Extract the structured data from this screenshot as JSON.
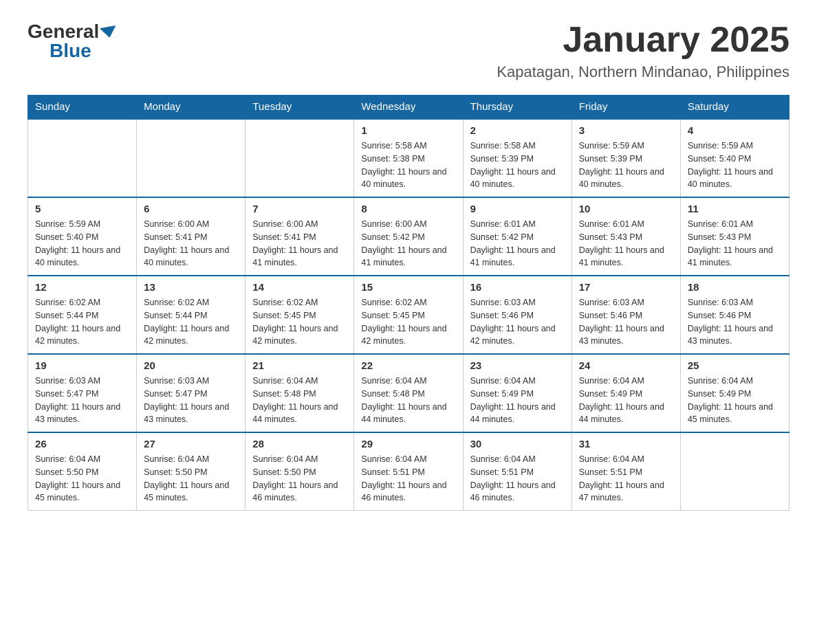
{
  "logo": {
    "general": "General",
    "blue": "Blue"
  },
  "title": "January 2025",
  "location": "Kapatagan, Northern Mindanao, Philippines",
  "weekdays": [
    "Sunday",
    "Monday",
    "Tuesday",
    "Wednesday",
    "Thursday",
    "Friday",
    "Saturday"
  ],
  "weeks": [
    [
      {
        "day": "",
        "info": ""
      },
      {
        "day": "",
        "info": ""
      },
      {
        "day": "",
        "info": ""
      },
      {
        "day": "1",
        "info": "Sunrise: 5:58 AM\nSunset: 5:38 PM\nDaylight: 11 hours and 40 minutes."
      },
      {
        "day": "2",
        "info": "Sunrise: 5:58 AM\nSunset: 5:39 PM\nDaylight: 11 hours and 40 minutes."
      },
      {
        "day": "3",
        "info": "Sunrise: 5:59 AM\nSunset: 5:39 PM\nDaylight: 11 hours and 40 minutes."
      },
      {
        "day": "4",
        "info": "Sunrise: 5:59 AM\nSunset: 5:40 PM\nDaylight: 11 hours and 40 minutes."
      }
    ],
    [
      {
        "day": "5",
        "info": "Sunrise: 5:59 AM\nSunset: 5:40 PM\nDaylight: 11 hours and 40 minutes."
      },
      {
        "day": "6",
        "info": "Sunrise: 6:00 AM\nSunset: 5:41 PM\nDaylight: 11 hours and 40 minutes."
      },
      {
        "day": "7",
        "info": "Sunrise: 6:00 AM\nSunset: 5:41 PM\nDaylight: 11 hours and 41 minutes."
      },
      {
        "day": "8",
        "info": "Sunrise: 6:00 AM\nSunset: 5:42 PM\nDaylight: 11 hours and 41 minutes."
      },
      {
        "day": "9",
        "info": "Sunrise: 6:01 AM\nSunset: 5:42 PM\nDaylight: 11 hours and 41 minutes."
      },
      {
        "day": "10",
        "info": "Sunrise: 6:01 AM\nSunset: 5:43 PM\nDaylight: 11 hours and 41 minutes."
      },
      {
        "day": "11",
        "info": "Sunrise: 6:01 AM\nSunset: 5:43 PM\nDaylight: 11 hours and 41 minutes."
      }
    ],
    [
      {
        "day": "12",
        "info": "Sunrise: 6:02 AM\nSunset: 5:44 PM\nDaylight: 11 hours and 42 minutes."
      },
      {
        "day": "13",
        "info": "Sunrise: 6:02 AM\nSunset: 5:44 PM\nDaylight: 11 hours and 42 minutes."
      },
      {
        "day": "14",
        "info": "Sunrise: 6:02 AM\nSunset: 5:45 PM\nDaylight: 11 hours and 42 minutes."
      },
      {
        "day": "15",
        "info": "Sunrise: 6:02 AM\nSunset: 5:45 PM\nDaylight: 11 hours and 42 minutes."
      },
      {
        "day": "16",
        "info": "Sunrise: 6:03 AM\nSunset: 5:46 PM\nDaylight: 11 hours and 42 minutes."
      },
      {
        "day": "17",
        "info": "Sunrise: 6:03 AM\nSunset: 5:46 PM\nDaylight: 11 hours and 43 minutes."
      },
      {
        "day": "18",
        "info": "Sunrise: 6:03 AM\nSunset: 5:46 PM\nDaylight: 11 hours and 43 minutes."
      }
    ],
    [
      {
        "day": "19",
        "info": "Sunrise: 6:03 AM\nSunset: 5:47 PM\nDaylight: 11 hours and 43 minutes."
      },
      {
        "day": "20",
        "info": "Sunrise: 6:03 AM\nSunset: 5:47 PM\nDaylight: 11 hours and 43 minutes."
      },
      {
        "day": "21",
        "info": "Sunrise: 6:04 AM\nSunset: 5:48 PM\nDaylight: 11 hours and 44 minutes."
      },
      {
        "day": "22",
        "info": "Sunrise: 6:04 AM\nSunset: 5:48 PM\nDaylight: 11 hours and 44 minutes."
      },
      {
        "day": "23",
        "info": "Sunrise: 6:04 AM\nSunset: 5:49 PM\nDaylight: 11 hours and 44 minutes."
      },
      {
        "day": "24",
        "info": "Sunrise: 6:04 AM\nSunset: 5:49 PM\nDaylight: 11 hours and 44 minutes."
      },
      {
        "day": "25",
        "info": "Sunrise: 6:04 AM\nSunset: 5:49 PM\nDaylight: 11 hours and 45 minutes."
      }
    ],
    [
      {
        "day": "26",
        "info": "Sunrise: 6:04 AM\nSunset: 5:50 PM\nDaylight: 11 hours and 45 minutes."
      },
      {
        "day": "27",
        "info": "Sunrise: 6:04 AM\nSunset: 5:50 PM\nDaylight: 11 hours and 45 minutes."
      },
      {
        "day": "28",
        "info": "Sunrise: 6:04 AM\nSunset: 5:50 PM\nDaylight: 11 hours and 46 minutes."
      },
      {
        "day": "29",
        "info": "Sunrise: 6:04 AM\nSunset: 5:51 PM\nDaylight: 11 hours and 46 minutes."
      },
      {
        "day": "30",
        "info": "Sunrise: 6:04 AM\nSunset: 5:51 PM\nDaylight: 11 hours and 46 minutes."
      },
      {
        "day": "31",
        "info": "Sunrise: 6:04 AM\nSunset: 5:51 PM\nDaylight: 11 hours and 47 minutes."
      },
      {
        "day": "",
        "info": ""
      }
    ]
  ]
}
